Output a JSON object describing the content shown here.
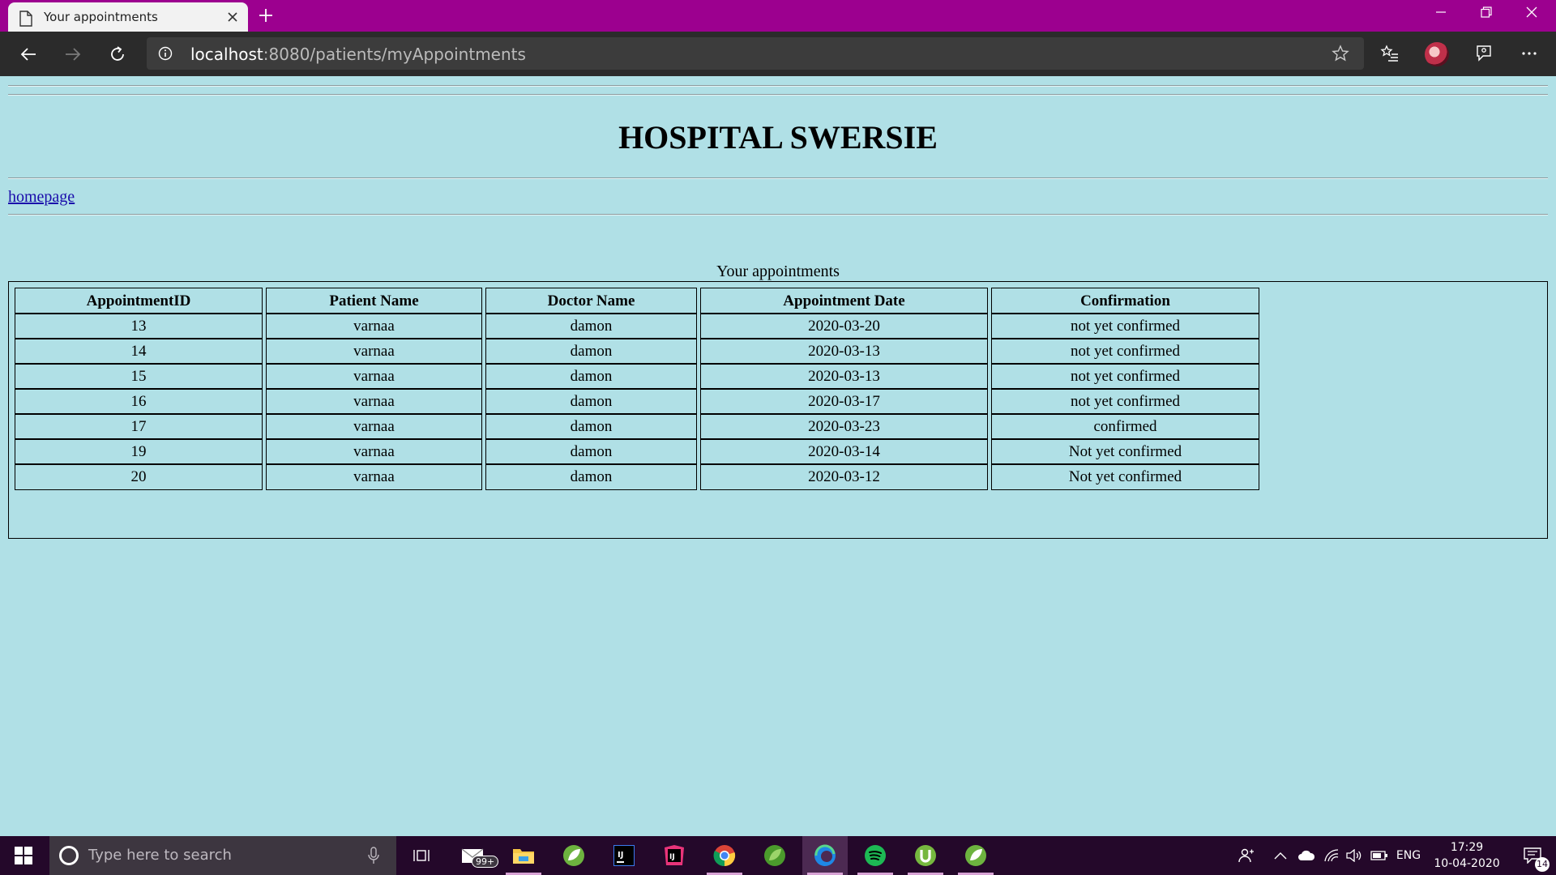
{
  "browser": {
    "tab_title": "Your appointments",
    "url_host": "localhost",
    "url_rest": ":8080/patients/myAppointments"
  },
  "page": {
    "heading": "HOSPITAL SWERSIE",
    "home_link": "homepage",
    "table_caption": "Your appointments",
    "columns": [
      "AppointmentID",
      "Patient Name",
      "Doctor Name",
      "Appointment Date",
      "Confirmation"
    ],
    "rows": [
      [
        "13",
        "varnaa",
        "damon",
        "2020-03-20",
        "not yet confirmed"
      ],
      [
        "14",
        "varnaa",
        "damon",
        "2020-03-13",
        "not yet confirmed"
      ],
      [
        "15",
        "varnaa",
        "damon",
        "2020-03-13",
        "not yet confirmed"
      ],
      [
        "16",
        "varnaa",
        "damon",
        "2020-03-17",
        "not yet confirmed"
      ],
      [
        "17",
        "varnaa",
        "damon",
        "2020-03-23",
        "confirmed"
      ],
      [
        "19",
        "varnaa",
        "damon",
        "2020-03-14",
        "Not yet confirmed"
      ],
      [
        "20",
        "varnaa",
        "damon",
        "2020-03-12",
        "Not yet confirmed"
      ]
    ]
  },
  "taskbar": {
    "search_placeholder": "Type here to search",
    "mail_badge": "99+",
    "language": "ENG",
    "time": "17:29",
    "date": "10-04-2020",
    "notification_count": "14",
    "apps": [
      "mail-icon",
      "file-explorer-icon",
      "spring-tools-icon",
      "intellij-icon",
      "intellij-toolbox-icon",
      "chrome-icon",
      "spring-leaf-icon",
      "edge-icon",
      "spotify-icon",
      "utorrent-icon",
      "spring-boot-icon"
    ]
  },
  "colors": {
    "page_background": "#B0E0E6",
    "titlebar": "#9C008F",
    "address_bar": "#2B2B2B",
    "taskbar": "#24082A",
    "link": "#1A0DAB"
  }
}
